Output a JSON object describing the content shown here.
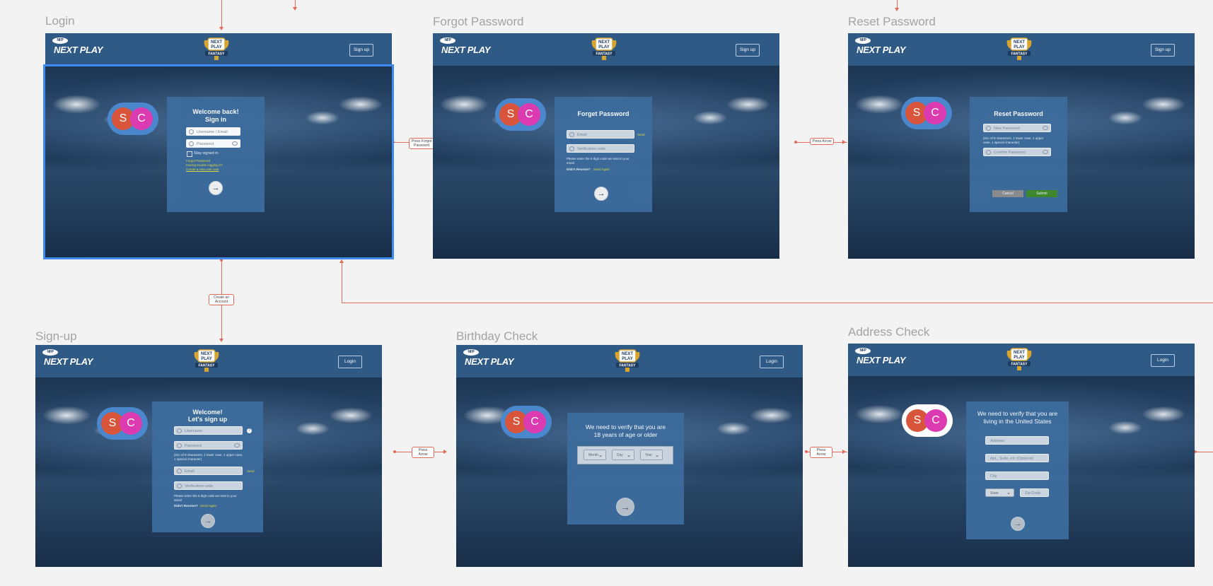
{
  "brand": {
    "logo_tag": "NFP",
    "logo_text": "NEXT PLAY",
    "center_logo_line1": "NEXT",
    "center_logo_line2": "PLAY",
    "center_logo_line3": "FANTASY"
  },
  "avatars": {
    "s": "S",
    "c": "C"
  },
  "frames": {
    "login": {
      "title": "Login",
      "header_button": "Sign up",
      "card_title_1": "Welcome back!",
      "card_title_2": "Sign in",
      "username_placeholder": "Username / Email",
      "password_placeholder": "Password",
      "stay_signed_in": "Stay signed in",
      "forgot_password": "Forgot Password",
      "trouble": "Having trouble logging in?",
      "create_account": "Create a new user now"
    },
    "forgot": {
      "title": "Forgot Password",
      "header_button": "Sign up",
      "card_title": "Forget Password",
      "email_placeholder": "Email",
      "send": "Send",
      "code_placeholder": "Verification code",
      "hint": "Please enter the 6 digit code we sent to your email",
      "didnt_receive": "Didn't Receive?",
      "send_again": "Send Again"
    },
    "reset": {
      "title": "Reset Password",
      "header_button": "Sign up",
      "card_title": "Reset Password",
      "new_password": "New Password",
      "rules": "(min of 8 characters, 1 lower case, 1 upper case, 1 special character)",
      "confirm_password": "Confirm Password",
      "cancel": "Cancel",
      "submit": "Submit"
    },
    "signup": {
      "title": "Sign-up",
      "header_button": "Login",
      "card_title_1": "Welcome!",
      "card_title_2": "Let's sign up",
      "username_placeholder": "Username",
      "password_placeholder": "Password",
      "rules": "(min of 8 characters, 1 lower case, 1 upper case, 1 special character)",
      "email_placeholder": "Email",
      "send": "Send",
      "code_placeholder": "Verification code",
      "hint": "Please enter the 6 digit code we sent to your email",
      "didnt_receive": "Didn't Receive?",
      "send_again": "Send Again"
    },
    "birthday": {
      "title": "Birthday Check",
      "header_button": "Login",
      "card_title": "We need to verify that you are 18 years of age or older",
      "month": "Month",
      "day": "Day",
      "year": "Year"
    },
    "address": {
      "title": "Address Check",
      "header_button": "Login",
      "card_title": "We need to verify that you are living in the United States",
      "address": "Address",
      "apt": "Apt., Suite, etc (Optional)",
      "city": "City",
      "state": "State",
      "zip": "Zip Code"
    }
  },
  "connectors": {
    "press_forgot": "Press Forgot Password",
    "press_arrow_1": "Press Arrow",
    "create_account": "Create an Account",
    "press_arrow_2": "Press Arrow",
    "press_arrow_3": "Press Arrow"
  },
  "colors": {
    "header": "#2f5a85",
    "card": "#3c6c9d",
    "connector": "#e36a58",
    "selection": "#3f8cf0",
    "submit": "#3e8a2a",
    "cancel": "#8d8d8d"
  }
}
